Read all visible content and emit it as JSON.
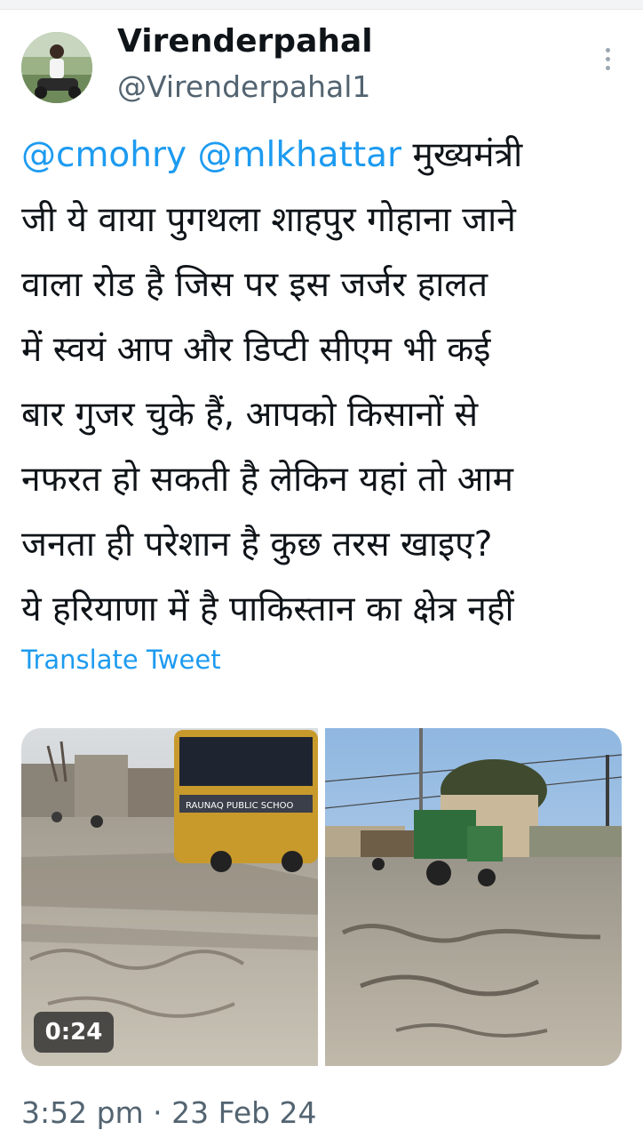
{
  "author": {
    "name": "Virenderpahal",
    "handle": "@Virenderpahal1"
  },
  "tweet": {
    "line1_mention1": "@cmohry",
    "line1_mention2": "@mlkhattar",
    "line1_text": "मुख्यमंत्री",
    "line2": "जी ये वाया पुगथला शाहपुर गोहाना जाने",
    "line3": "वाला रोड है जिस पर इस जर्जर हालत",
    "line4": "में स्वयं आप और डिप्टी सीएम भी कई",
    "line5": "बार गुजर चुके हैं, आपको किसानों से",
    "line6": "नफरत हो सकती है लेकिन यहां तो आम",
    "line7": "जनता ही परेशान है कुछ तरस खाइए?",
    "line8": "ये हरियाणा में है पाकिस्तान का क्षेत्र नहीं"
  },
  "translate_label": "Translate Tweet",
  "media": {
    "video_duration": "0:24",
    "bus_text": "RAUNAQ PUBLIC SCHOO"
  },
  "timestamp": "3:52 pm · 23 Feb 24",
  "colors": {
    "link": "#1d9bf0",
    "secondary_text": "#536471",
    "primary_text": "#0f1419"
  },
  "icons": {
    "more": "more-options-icon"
  }
}
